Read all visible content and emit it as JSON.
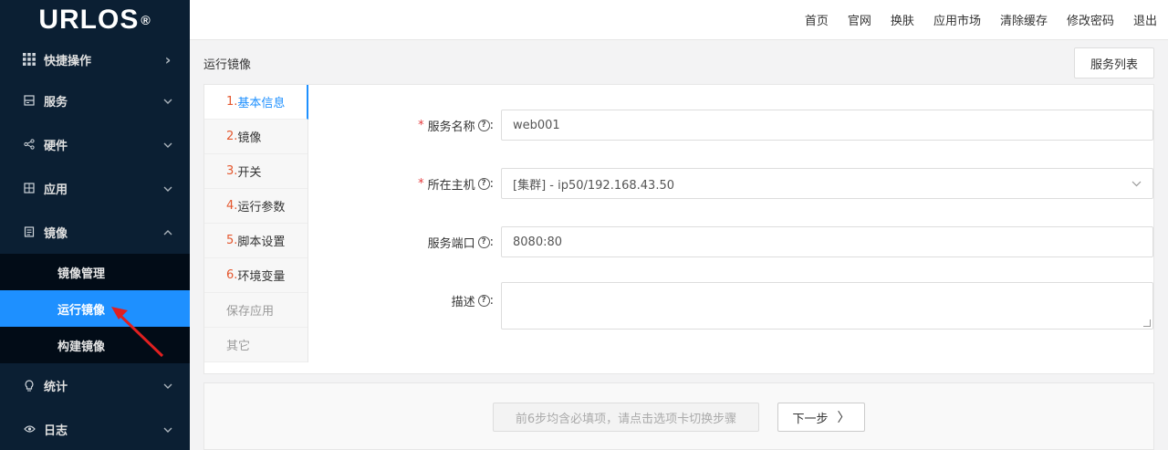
{
  "logo": {
    "text": "URLOS",
    "mark": "®"
  },
  "sidebar": {
    "items": [
      {
        "label": "快捷操作",
        "icon": "grid-icon",
        "chevron": "›"
      },
      {
        "label": "服务",
        "icon": "server-icon",
        "chevron": "⌄"
      },
      {
        "label": "硬件",
        "icon": "share-icon",
        "chevron": "⌄"
      },
      {
        "label": "应用",
        "icon": "apps-icon",
        "chevron": "⌄"
      },
      {
        "label": "镜像",
        "icon": "document-icon",
        "chevron": "⌃"
      },
      {
        "label": "统计",
        "icon": "bulb-icon",
        "chevron": "⌄"
      },
      {
        "label": "日志",
        "icon": "eye-icon",
        "chevron": "⌄"
      }
    ],
    "sub_items": [
      {
        "label": "镜像管理"
      },
      {
        "label": "运行镜像"
      },
      {
        "label": "构建镜像"
      }
    ]
  },
  "topbar": {
    "links": [
      "首页",
      "官网",
      "换肤",
      "应用市场",
      "清除缓存",
      "修改密码",
      "退出"
    ]
  },
  "page": {
    "title": "运行镜像",
    "list_button": "服务列表"
  },
  "steps": [
    {
      "num": "1.",
      "label": "基本信息"
    },
    {
      "num": "2.",
      "label": "镜像"
    },
    {
      "num": "3.",
      "label": "开关"
    },
    {
      "num": "4.",
      "label": "运行参数"
    },
    {
      "num": "5.",
      "label": "脚本设置"
    },
    {
      "num": "6.",
      "label": "环境变量"
    },
    {
      "num": "",
      "label": "保存应用"
    },
    {
      "num": "",
      "label": "其它"
    }
  ],
  "form": {
    "service_name": {
      "label": "服务名称",
      "required": "*",
      "value": "web001"
    },
    "host": {
      "label": "所在主机",
      "required": "*",
      "value": "[集群] - ip50/192.168.43.50"
    },
    "port": {
      "label": "服务端口",
      "value": "8080:80"
    },
    "description": {
      "label": "描述",
      "value": ""
    },
    "help_glyph": "?",
    "colon": ":"
  },
  "footer": {
    "hint": "前6步均含必填项，请点击选项卡切换步骤",
    "next": "下一步",
    "next_glyph": "〉"
  },
  "colors": {
    "sidebar_bg": "#0b1f33",
    "active": "#1e90ff",
    "step_num": "#e4572e",
    "annotation_arrow": "#e02020"
  }
}
